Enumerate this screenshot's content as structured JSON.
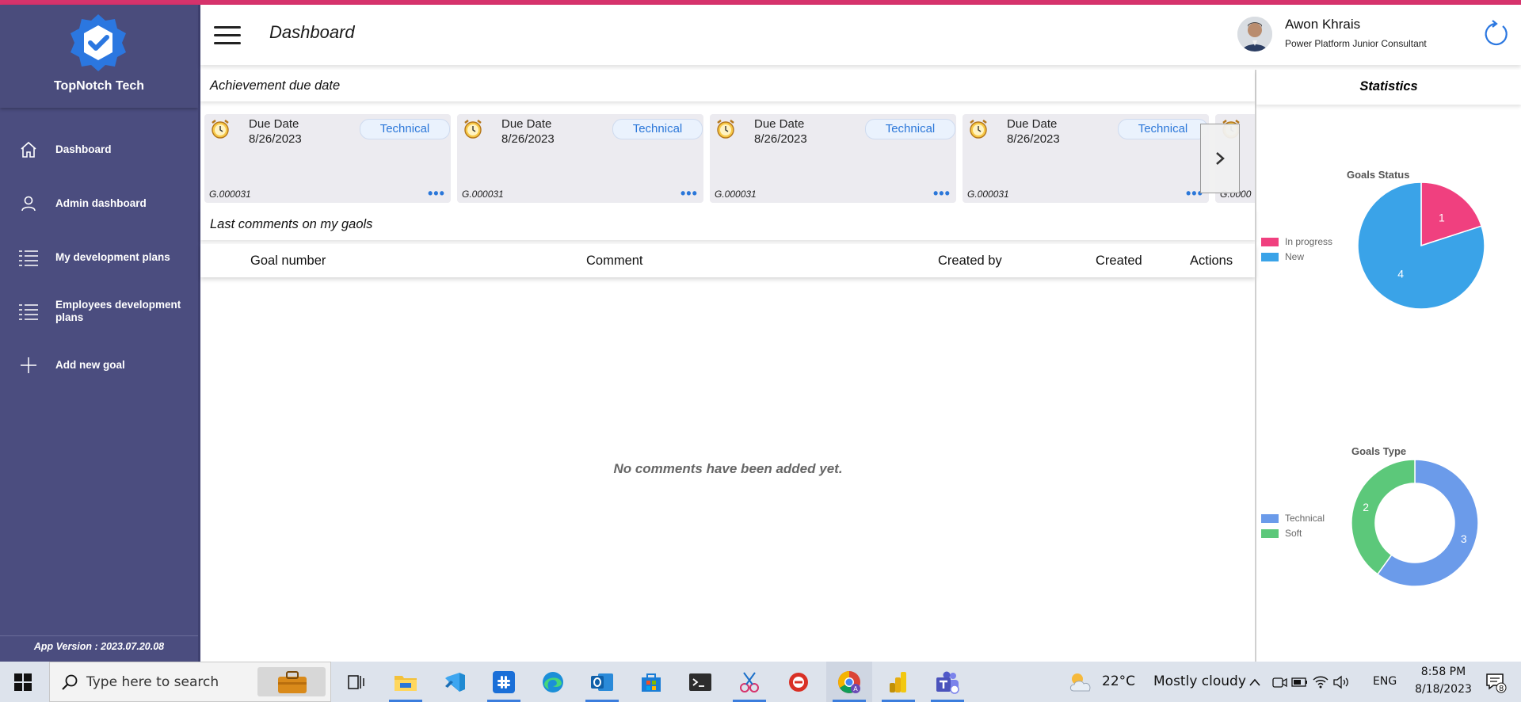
{
  "app": {
    "name": "TopNotch Tech",
    "version": "App Version : 2023.07.20.08"
  },
  "sidebar": {
    "items": [
      {
        "label": "Dashboard",
        "icon": "home-icon"
      },
      {
        "label": "Admin dashboard",
        "icon": "user-icon"
      },
      {
        "label": "My development plans",
        "icon": "list-icon"
      },
      {
        "label": "Employees development plans",
        "icon": "list-icon"
      },
      {
        "label": "Add new goal",
        "icon": "plus-icon"
      }
    ]
  },
  "header": {
    "title": "Dashboard",
    "user": {
      "name": "Awon Khrais",
      "role": "Power Platform Junior Consultant"
    }
  },
  "achievements": {
    "title": "Achievement due date",
    "cards": [
      {
        "due_label": "Due Date",
        "due_date": "8/26/2023",
        "type": "Technical",
        "code": "G.000031"
      },
      {
        "due_label": "Due Date",
        "due_date": "8/26/2023",
        "type": "Technical",
        "code": "G.000031"
      },
      {
        "due_label": "Due Date",
        "due_date": "8/26/2023",
        "type": "Technical",
        "code": "G.000031"
      },
      {
        "due_label": "Due Date",
        "due_date": "8/26/2023",
        "type": "Technical",
        "code": "G.000031"
      },
      {
        "due_label": "",
        "due_date": "",
        "type": "",
        "code": "G.0000"
      }
    ]
  },
  "comments": {
    "title": "Last comments on my gaols",
    "columns": [
      "Goal number",
      "Comment",
      "Created by",
      "Created",
      "Actions"
    ],
    "empty_message": "No comments have been added yet."
  },
  "statistics": {
    "title": "Statistics",
    "colors": {
      "in_progress": "#F0407F",
      "new": "#3AA3E8",
      "technical": "#6B9BEA",
      "soft": "#5CC87A"
    }
  },
  "chart_data": [
    {
      "type": "pie",
      "title": "Goals Status",
      "categories": [
        "In progress",
        "New"
      ],
      "values": [
        1,
        4
      ],
      "legend": "left"
    },
    {
      "type": "pie",
      "title": "Goals Type",
      "categories": [
        "Technical",
        "Soft"
      ],
      "values": [
        3,
        2
      ],
      "donut": true,
      "legend": "left"
    }
  ],
  "taskbar": {
    "search_placeholder": "Type here to search",
    "weather": {
      "temp": "22°C",
      "condition": "Mostly cloudy"
    },
    "language": "ENG",
    "time": "8:58 PM",
    "date": "8/18/2023",
    "notification_count": "8"
  }
}
